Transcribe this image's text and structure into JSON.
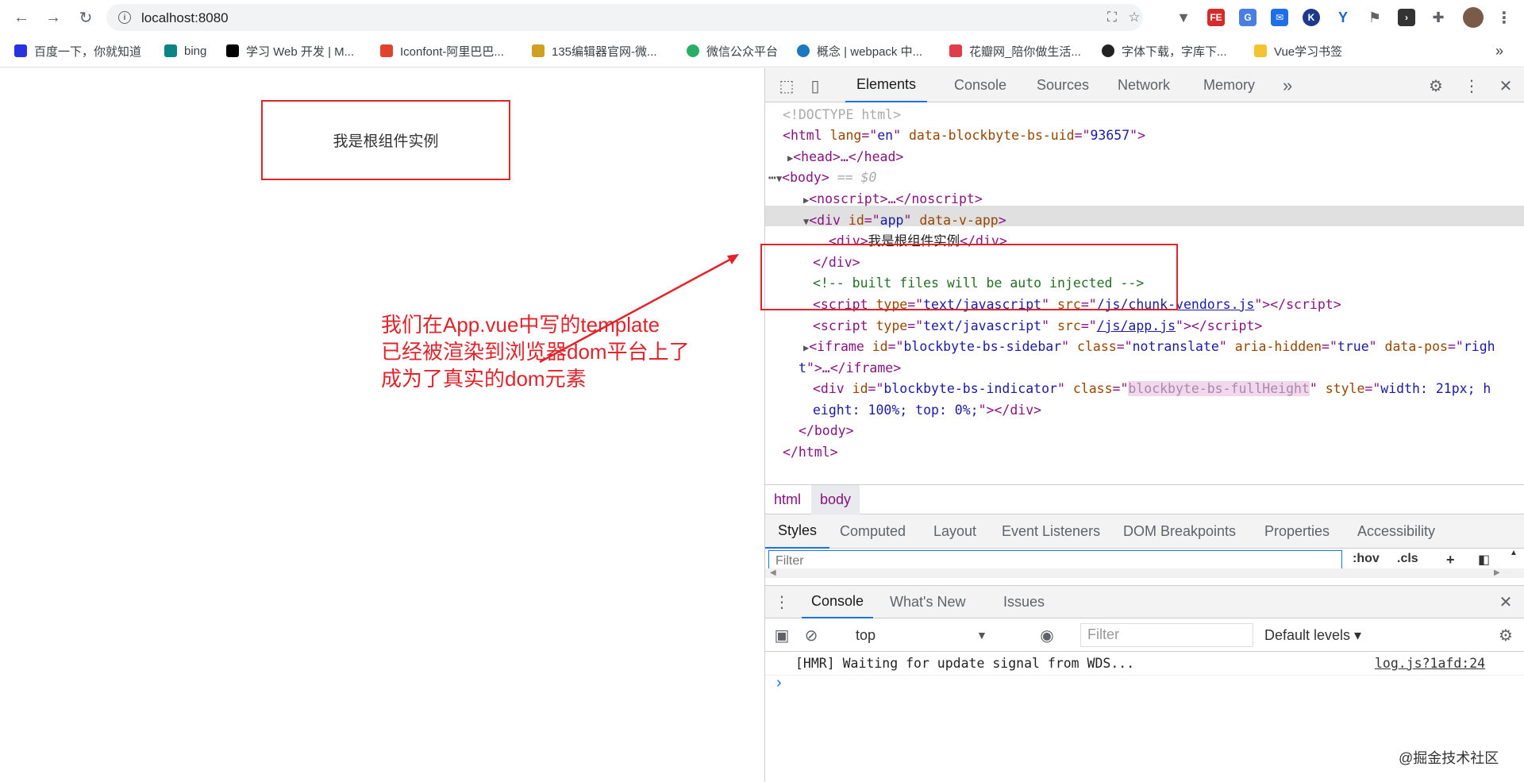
{
  "browser": {
    "url": "localhost:8080",
    "bookmarks": [
      {
        "label": "百度一下，你就知道",
        "color": "#2932e1"
      },
      {
        "label": "bing",
        "color": "#0c8484"
      },
      {
        "label": "学习 Web 开发 | M...",
        "color": "#000000"
      },
      {
        "label": "Iconfont-阿里巴巴...",
        "color": "#e0422c"
      },
      {
        "label": "135编辑器官网-微...",
        "color": "#d0a020"
      },
      {
        "label": "微信公众平台",
        "color": "#2aae67"
      },
      {
        "label": "概念 | webpack 中...",
        "color": "#1c78c0"
      },
      {
        "label": "花瓣网_陪你做生活...",
        "color": "#e03c4c"
      },
      {
        "label": "字体下载，字库下...",
        "color": "#222222"
      },
      {
        "label": "Vue学习书签",
        "color": "#f4c430"
      }
    ],
    "more_bookmarks": "»"
  },
  "page": {
    "app_text": "我是根组件实例",
    "annotation": [
      "我们在App.vue中写的template",
      "已经被渲染到浏览器dom平台上了",
      "成为了真实的dom元素"
    ],
    "watermark": "@掘金技术社区",
    "accent": "#e0242c"
  },
  "devtools": {
    "tabs": [
      "Elements",
      "Console",
      "Sources",
      "Network",
      "Memory"
    ],
    "more_tabs": "»",
    "dom": {
      "doctype": "<!DOCTYPE html>",
      "html_open": {
        "tag": "html",
        "attrs": [
          [
            "lang",
            "en"
          ],
          [
            "data-blockbyte-bs-uid",
            "93657"
          ]
        ]
      },
      "head": "<head>…</head>",
      "body_sel": "== $0",
      "noscript": "<noscript>…</noscript>",
      "app_div": {
        "id": "app",
        "flag": "data-v-app"
      },
      "app_child_text": "我是根组件实例",
      "comment": "<!-- built files will be auto injected -->",
      "script1_src": "/js/chunk-vendors.js",
      "script2_src": "/js/app.js",
      "script_type": "text/javascript",
      "iframe": {
        "id": "blockbyte-bs-sidebar",
        "class": "notranslate",
        "aria_hidden": "true",
        "pos_l1": "righ",
        "pos_l2": "t"
      },
      "indicator": {
        "id": "blockbyte-bs-indicator",
        "class": "blockbyte-bs-fullHeight",
        "style_l1": "width: 21px; h",
        "style_l2": "eight: 100%; top: 0%;"
      }
    },
    "breadcrumbs": [
      "html",
      "body"
    ],
    "style_tabs": [
      "Styles",
      "Computed",
      "Layout",
      "Event Listeners",
      "DOM Breakpoints",
      "Properties",
      "Accessibility"
    ],
    "filter_placeholder": "Filter",
    "hov": ":hov",
    "cls": ".cls",
    "drawer_tabs": [
      "Console",
      "What's New",
      "Issues"
    ],
    "context": "top",
    "console_filter_placeholder": "Filter",
    "levels": "Default levels ▾",
    "message": "[HMR] Waiting for update signal from WDS...",
    "message_source": "log.js?1afd:24",
    "prompt": "›"
  }
}
